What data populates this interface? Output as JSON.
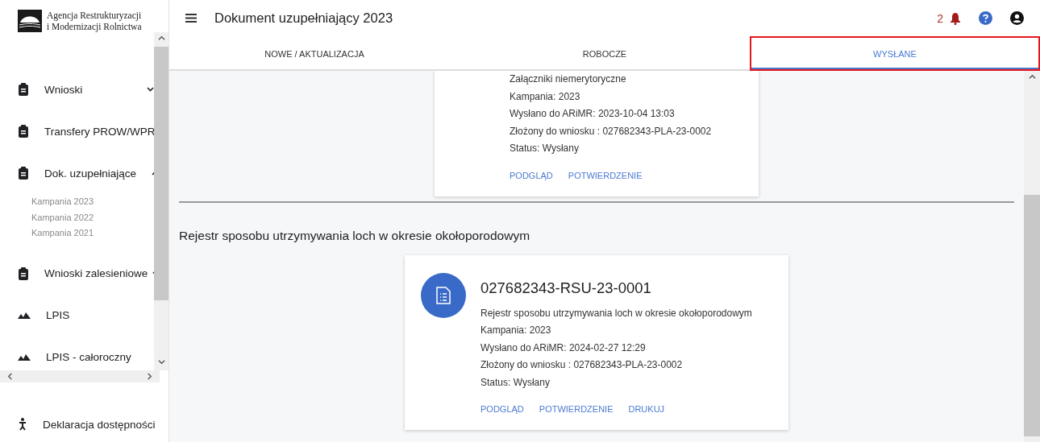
{
  "logo": {
    "lines": [
      "Agencja Restrukturyzacji",
      "i Modernizacji Rolnictwa"
    ]
  },
  "sidebar": {
    "items": [
      {
        "label": "Wnioski",
        "expanded": false
      },
      {
        "label": "Transfery PROW/WPR",
        "expanded": false
      },
      {
        "label": "Dok. uzupełniające",
        "expanded": true,
        "children": [
          {
            "label": "Kampania 2023"
          },
          {
            "label": "Kampania 2022"
          },
          {
            "label": "Kampania 2021"
          }
        ]
      },
      {
        "label": "Wnioski zalesieniowe",
        "expanded": false
      },
      {
        "label": "LPIS"
      },
      {
        "label": "LPIS - całoroczny"
      }
    ],
    "footer_item": {
      "label": "Deklaracja dostępności"
    }
  },
  "header": {
    "title": "Dokument uzupełniający 2023",
    "notifications": "2"
  },
  "tabs": [
    {
      "label": "NOWE / AKTUALIZACJA",
      "selected": false,
      "highlighted": false
    },
    {
      "label": "ROBOCZE",
      "selected": false,
      "highlighted": false
    },
    {
      "label": "WYSŁANE",
      "selected": true,
      "highlighted": true
    }
  ],
  "sections": [
    {
      "cards": [
        {
          "lines": [
            "Załączniki niemerytoryczne",
            "Kampania: 2023",
            "Wysłano do ARiMR: 2023-10-04 13:03",
            "Złożony do wniosku : 027682343-PLA-23-0002",
            "Status: Wysłany"
          ],
          "actions": [
            "PODGLĄD",
            "POTWIERDZENIE"
          ]
        }
      ]
    },
    {
      "heading": "Rejestr sposobu utrzymywania loch w okresie okołoporodowym",
      "cards": [
        {
          "title": "027682343-RSU-23-0001",
          "lines": [
            "Rejestr sposobu utrzymywania loch w okresie okołoporodowym",
            "Kampania: 2023",
            "Wysłano do ARiMR: 2024-02-27 12:29",
            "Złożony do wniosku : 027682343-PLA-23-0002",
            "Status: Wysłany"
          ],
          "actions": [
            "PODGLĄD",
            "POTWIERDZENIE",
            "DRUKUJ"
          ]
        }
      ]
    }
  ]
}
